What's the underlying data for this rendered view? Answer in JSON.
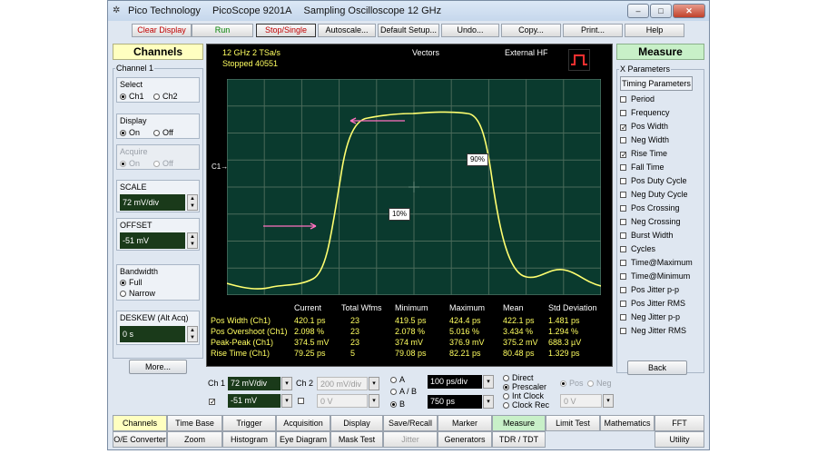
{
  "window": {
    "title_vendor": "Pico Technology",
    "title_product": "PicoScope 9201A",
    "title_desc": "Sampling Oscilloscope 12 GHz",
    "btn_min": "–",
    "btn_max": "□",
    "btn_close": "✕"
  },
  "toolbar": {
    "clear_display": "Clear Display",
    "run": "Run",
    "stop_single": "Stop/Single",
    "autoscale": "Autoscale...",
    "default_setup": "Default Setup...",
    "undo": "Undo...",
    "copy": "Copy...",
    "print": "Print...",
    "help": "Help"
  },
  "channels": {
    "header": "Channels",
    "group": "Channel 1",
    "select_label": "Select",
    "select_opts": [
      "Ch1",
      "Ch2"
    ],
    "display_label": "Display",
    "display_opts": [
      "On",
      "Off"
    ],
    "acquire_label": "Acquire",
    "acquire_opts": [
      "On",
      "Off"
    ],
    "scale_label": "SCALE",
    "scale_value": "72 mV/div",
    "offset_label": "OFFSET",
    "offset_value": "-51 mV",
    "bandwidth_label": "Bandwidth",
    "bandwidth_opts": [
      "Full",
      "Narrow"
    ],
    "deskew_label": "DESKEW (Alt Acq)",
    "deskew_value": "0 s",
    "more": "More..."
  },
  "scope": {
    "rate": "12 GHz  2 TSa/s",
    "status": "Stopped 40551",
    "mode": "Vectors",
    "trigger": "External HF",
    "c1_marker": "C1",
    "label_90": "90%",
    "label_10": "10%",
    "trace_color": "#ffff70",
    "arrow_color": "#ff70c0"
  },
  "measurements": {
    "headers": [
      "Current",
      "Total Wfms",
      "Minimum",
      "Maximum",
      "Mean",
      "Std Deviation"
    ],
    "rows": [
      [
        "Pos Width (Ch1)",
        "420.1 ps",
        "23",
        "419.5 ps",
        "424.4 ps",
        "422.1 ps",
        "1.481 ps"
      ],
      [
        "Pos Overshoot (Ch1)",
        "2.098 %",
        "23",
        "2.078 %",
        "5.016 %",
        "3.434 %",
        "1.294 %"
      ],
      [
        "Peak-Peak (Ch1)",
        "374.5 mV",
        "23",
        "374 mV",
        "376.9 mV",
        "375.2 mV",
        "688.3 µV"
      ],
      [
        "Rise Time (Ch1)",
        "79.25 ps",
        "5",
        "79.08 ps",
        "82.21 ps",
        "80.48 ps",
        "1.329 ps"
      ]
    ]
  },
  "bottom": {
    "ch1_label": "Ch 1",
    "ch1_scale": "72 mV/div",
    "ch1_offset": "-51 mV",
    "ch2_label": "Ch 2",
    "ch2_scale": "200 mV/div",
    "ch2_offset": "0 V",
    "mode_opts": [
      "A",
      "A / B",
      "B"
    ],
    "timebase": "100 ps/div",
    "delay": "750 ps",
    "trig_opts": [
      "Direct",
      "Prescaler",
      "Int Clock",
      "Clock Rec"
    ],
    "slope_opts": [
      "Pos",
      "Neg"
    ],
    "trig_level": "0 V"
  },
  "measure": {
    "header": "Measure",
    "group": "X Parameters",
    "tab": "Timing Parameters",
    "items": [
      {
        "label": "Period",
        "checked": false
      },
      {
        "label": "Frequency",
        "checked": false
      },
      {
        "label": "Pos Width",
        "checked": true
      },
      {
        "label": "Neg Width",
        "checked": false
      },
      {
        "label": "Rise Time",
        "checked": true
      },
      {
        "label": "Fall Time",
        "checked": false
      },
      {
        "label": "Pos Duty Cycle",
        "checked": false
      },
      {
        "label": "Neg Duty Cycle",
        "checked": false
      },
      {
        "label": "Pos Crossing",
        "checked": false
      },
      {
        "label": "Neg Crossing",
        "checked": false
      },
      {
        "label": "Burst Width",
        "checked": false
      },
      {
        "label": "Cycles",
        "checked": false
      },
      {
        "label": "Time@Maximum",
        "checked": false
      },
      {
        "label": "Time@Minimum",
        "checked": false
      },
      {
        "label": "Pos Jitter p-p",
        "checked": false
      },
      {
        "label": "Pos Jitter RMS",
        "checked": false
      },
      {
        "label": "Neg Jitter p-p",
        "checked": false
      },
      {
        "label": "Neg Jitter RMS",
        "checked": false
      }
    ],
    "back": "Back"
  },
  "tabs_row1": [
    "Channels",
    "Time Base",
    "Trigger",
    "Acquisition",
    "Display",
    "Save/Recall",
    "Marker",
    "Measure",
    "Limit Test",
    "Mathematics",
    "FFT"
  ],
  "tabs_row2": [
    "O/E Converter",
    "Zoom",
    "Histogram",
    "Eye Diagram",
    "Mask Test",
    "Jitter",
    "Generators",
    "TDR / TDT",
    "Utility"
  ]
}
